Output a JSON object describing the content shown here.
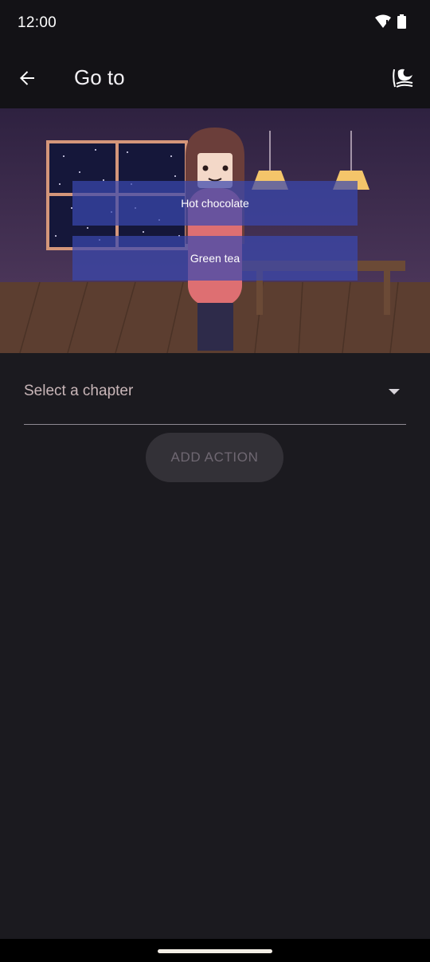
{
  "status_bar": {
    "time": "12:00",
    "icons": [
      "wifi-icon",
      "battery-icon"
    ]
  },
  "app_bar": {
    "title": "Go to",
    "back_icon": "arrow-back-icon",
    "action_icon": "theme-icon"
  },
  "scene": {
    "choices": [
      {
        "label": "Hot chocolate"
      },
      {
        "label": "Green tea"
      }
    ],
    "colors": {
      "sky_top": "#2e2140",
      "sky_bottom": "#4a3558",
      "floor": "#5c3e30",
      "window_frame": "#d4967a",
      "choice_overlay": "#3a48af"
    }
  },
  "form": {
    "chapter_select": {
      "placeholder": "Select a chapter"
    },
    "add_action_label": "ADD ACTION"
  },
  "colors": {
    "background": "#1b1a1f",
    "app_bar": "#131216"
  }
}
